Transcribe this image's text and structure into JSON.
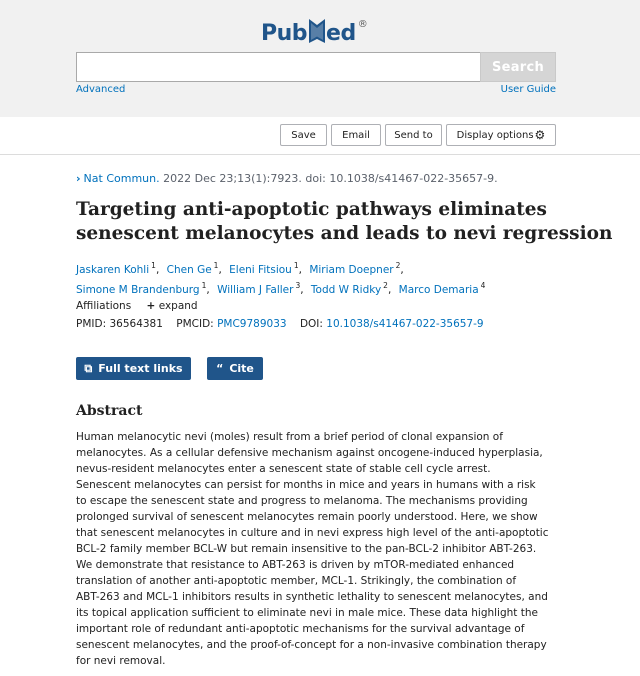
{
  "header": {
    "logo_left": "Pub",
    "logo_right": "ed",
    "logo_reg": "®",
    "search": {
      "placeholder": "",
      "button": "Search"
    },
    "advanced": "Advanced",
    "user_guide": "User Guide"
  },
  "actions": {
    "save": "Save",
    "email": "Email",
    "send_to": "Send to",
    "display_options": "Display options"
  },
  "article": {
    "journal": "Nat Commun.",
    "citation_rest": " 2022 Dec 23;13(1):7923. doi: 10.1038/s41467-022-35657-9.",
    "title_lines": [
      "Targeting anti-apoptotic pathways eliminates",
      "senescent melanocytes and leads to nevi regression"
    ],
    "authors": [
      {
        "name": "Jaskaren Kohli",
        "aff": "1"
      },
      {
        "name": "Chen Ge",
        "aff": "1"
      },
      {
        "name": "Eleni Fitsiou",
        "aff": "1"
      },
      {
        "name": "Miriam Doepner",
        "aff": "2"
      },
      {
        "name": "Simone M Brandenburg",
        "aff": "1"
      },
      {
        "name": "William J Faller",
        "aff": "3"
      },
      {
        "name": "Todd W Ridky",
        "aff": "2"
      },
      {
        "name": "Marco Demaria",
        "aff": "4"
      }
    ],
    "affiliations_label": "Affiliations",
    "expand_label": "expand",
    "pmid_label": "PMID:",
    "pmid": "36564381",
    "pmcid_label": "PMCID:",
    "pmcid": "PMC9789033",
    "doi_label": "DOI:",
    "doi": "10.1038/s41467-022-35657-9"
  },
  "buttons": {
    "full_text": "Full text links",
    "cite": "Cite"
  },
  "abstract": {
    "heading": "Abstract",
    "lines": [
      "Human melanocytic nevi (moles) result from a brief period of clonal expansion of",
      "melanocytes. As a cellular defensive mechanism against oncogene-induced hyperplasia,",
      "nevus-resident melanocytes enter a senescent state of stable cell cycle arrest.",
      "Senescent melanocytes can persist for months in mice and years in humans with a risk",
      "to escape the senescent state and progress to melanoma. The mechanisms providing",
      "prolonged survival of senescent melanocytes remain poorly understood. Here, we show",
      "that senescent melanocytes in culture and in nevi express high level of the anti-apoptotic",
      "BCL-2 family member BCL-W but remain insensitive to the pan-BCL-2 inhibitor ABT-263.",
      "We demonstrate that resistance to ABT-263 is driven by mTOR-mediated enhanced",
      "translation of another anti-apoptotic member, MCL-1. Strikingly, the combination of",
      "ABT-263 and MCL-1 inhibitors results in synthetic lethality to senescent melanocytes, and",
      "its topical application sufficient to eliminate nevi in male mice. These data highlight the",
      "important role of redundant anti-apoptotic mechanisms for the survival advantage of",
      "senescent melanocytes, and the proof-of-concept for a non-invasive combination therapy",
      "for nevi removal."
    ]
  },
  "colors": {
    "brand": "#20558a",
    "link": "#0071bc",
    "header_bg": "#f1f1f1"
  },
  "icons": [
    "chevron-right-icon",
    "gear-icon",
    "plus-icon",
    "external-link-icon",
    "quote-icon"
  ]
}
